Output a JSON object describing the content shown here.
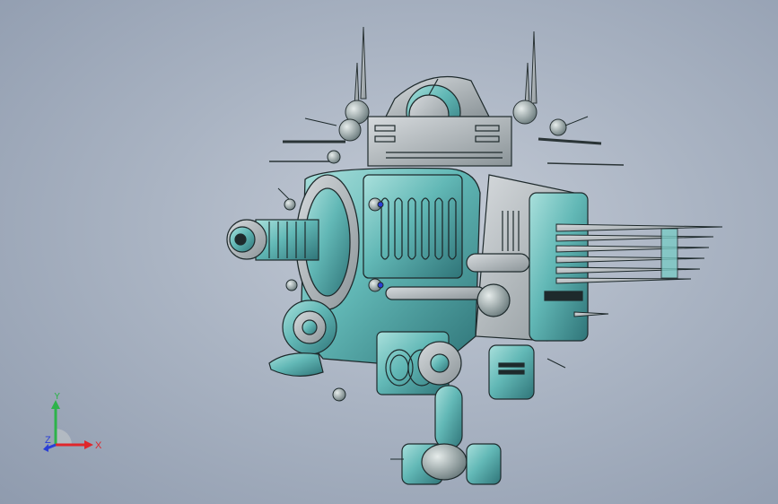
{
  "viewport": {
    "background_top": "#c4cbd6",
    "background_bottom": "#8f9bae",
    "model_color": "#6fbfbe",
    "model_shadow": "#3e7d80",
    "edge_color": "#1e2a2c"
  },
  "triad": {
    "x_label": "X",
    "y_label": "Y",
    "z_label": "Z",
    "x_color": "#e0262b",
    "y_color": "#2db34a",
    "z_color": "#2a3fd6"
  }
}
